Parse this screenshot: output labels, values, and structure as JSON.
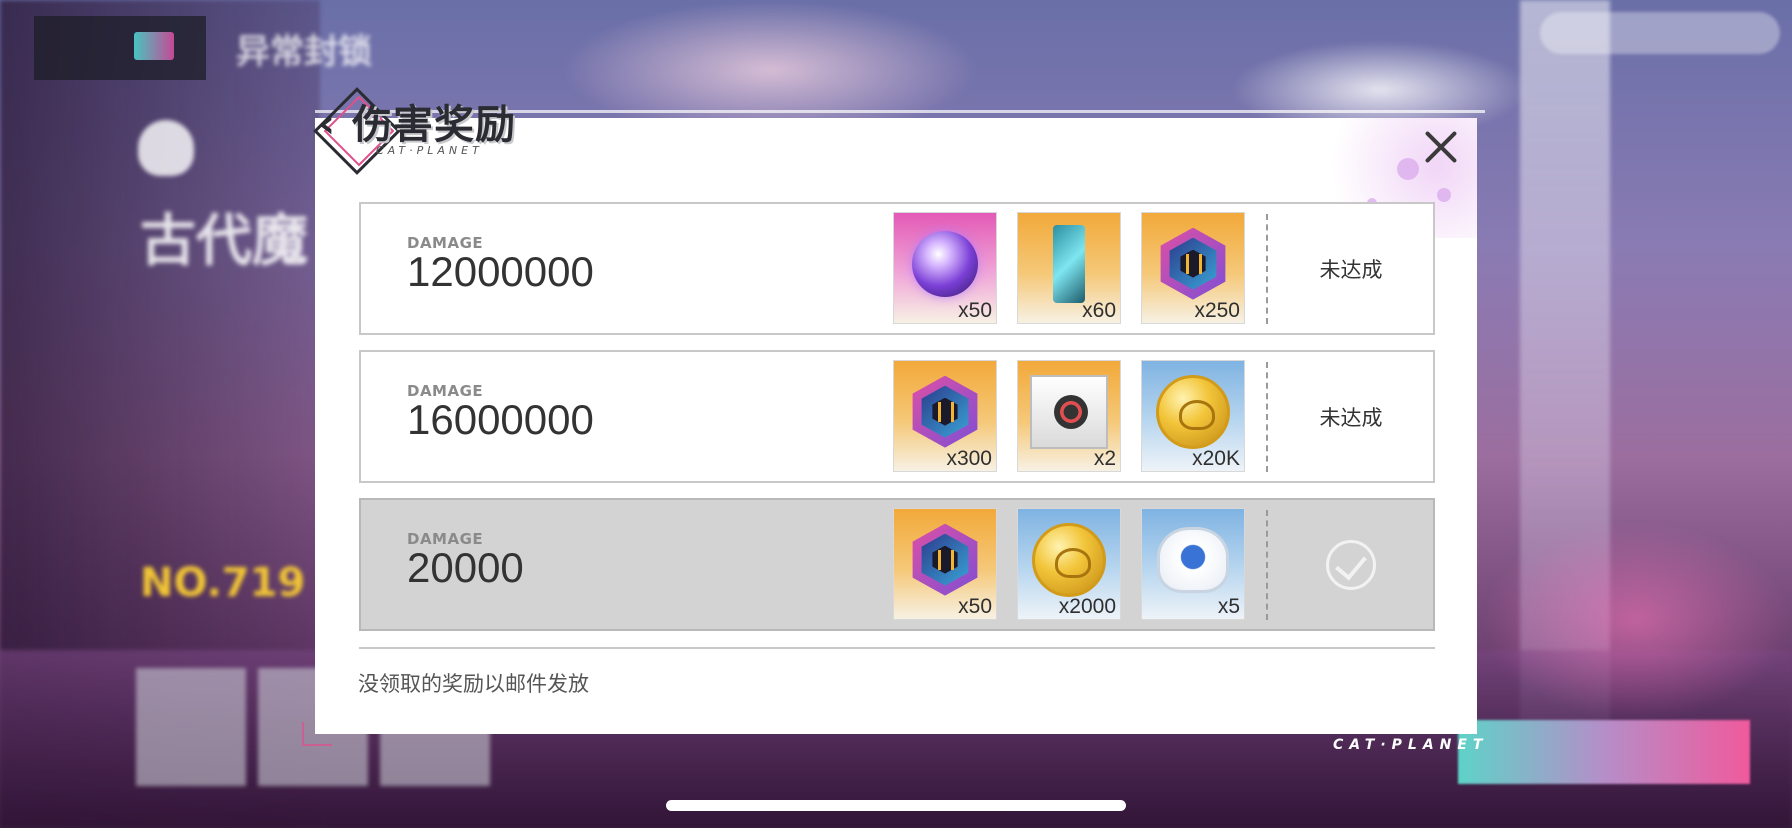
{
  "hud": {
    "title": "异常封锁",
    "big_name": "古代魔",
    "rank": "NO.719",
    "brand": "CAT·PLANET"
  },
  "modal": {
    "title": "伤害奖励",
    "subtitle": "CAT·PLANET",
    "footer_note": "没领取的奖励以邮件发放",
    "rows": [
      {
        "label": "DAMAGE",
        "value": "12000000",
        "status": "未达成",
        "claimed": false,
        "items": [
          {
            "icon": "purple-orb",
            "qty": "x50"
          },
          {
            "icon": "crystal-shard",
            "qty": "x60"
          },
          {
            "icon": "hex-badge",
            "qty": "x250"
          }
        ]
      },
      {
        "label": "DAMAGE",
        "value": "16000000",
        "status": "未达成",
        "claimed": false,
        "items": [
          {
            "icon": "hex-badge",
            "qty": "x300"
          },
          {
            "icon": "gift-box",
            "qty": "x2"
          },
          {
            "icon": "gold-coin",
            "qty": "x20K"
          }
        ]
      },
      {
        "label": "DAMAGE",
        "value": "20000",
        "status": "",
        "claimed": true,
        "items": [
          {
            "icon": "hex-badge",
            "qty": "x50"
          },
          {
            "icon": "gold-coin",
            "qty": "x2000"
          },
          {
            "icon": "cat-helmet",
            "qty": "x5"
          }
        ]
      }
    ]
  },
  "colors": {
    "accent_pink": "#e0508c",
    "accent_teal": "#4ee0d8",
    "row_done_bg": "#d3d3d3"
  }
}
